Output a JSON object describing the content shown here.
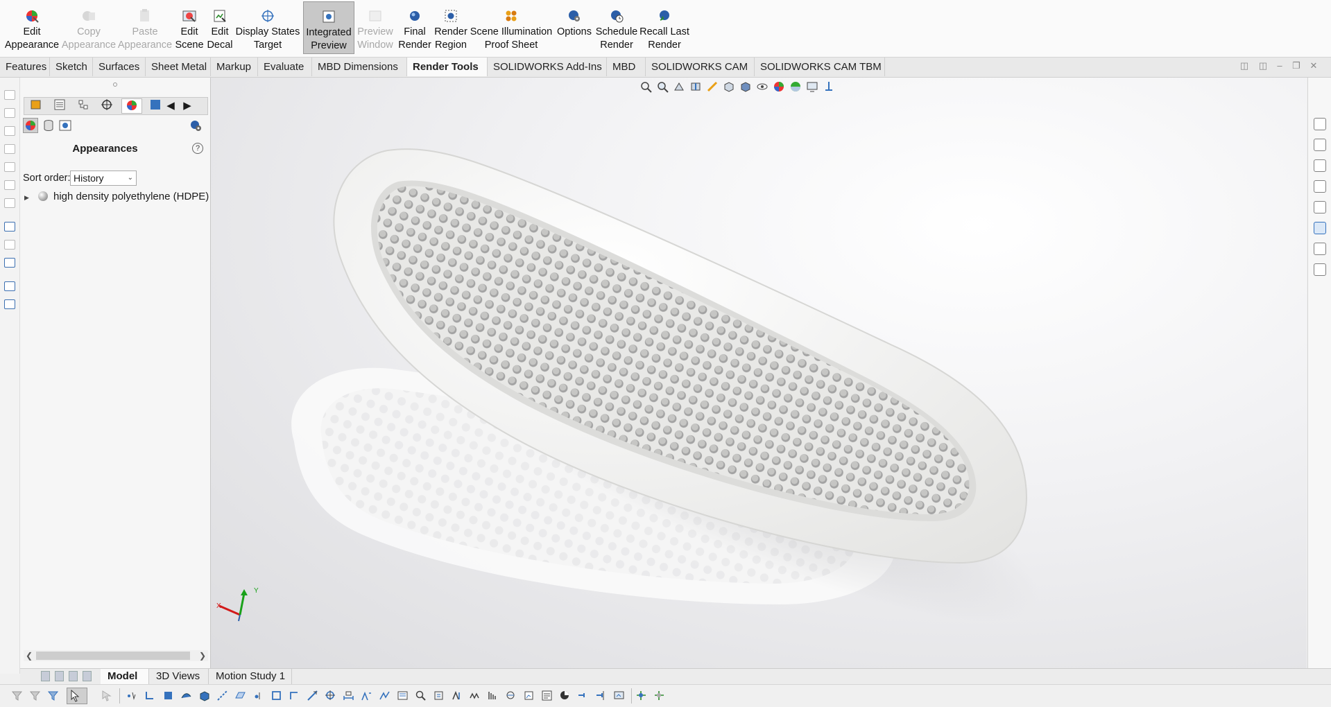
{
  "ribbon": {
    "buttons": [
      {
        "line1": "Edit",
        "line2": "Appearance",
        "icon": "edit-appearance-icon",
        "state": "enabled"
      },
      {
        "line1": "Copy",
        "line2": "Appearance",
        "icon": "copy-appearance-icon",
        "state": "disabled"
      },
      {
        "line1": "Paste",
        "line2": "Appearance",
        "icon": "paste-appearance-icon",
        "state": "disabled"
      },
      {
        "line1": "Edit",
        "line2": "Scene",
        "icon": "edit-scene-icon",
        "state": "enabled"
      },
      {
        "line1": "Edit",
        "line2": "Decal",
        "icon": "edit-decal-icon",
        "state": "enabled"
      },
      {
        "line1": "Display States",
        "line2": "Target",
        "icon": "display-states-target-icon",
        "state": "enabled"
      },
      {
        "line1": "Integrated",
        "line2": "Preview",
        "icon": "integrated-preview-icon",
        "state": "active"
      },
      {
        "line1": "Preview",
        "line2": "Window",
        "icon": "preview-window-icon",
        "state": "disabled"
      },
      {
        "line1": "Final",
        "line2": "Render",
        "icon": "final-render-icon",
        "state": "enabled"
      },
      {
        "line1": "Render",
        "line2": "Region",
        "icon": "render-region-icon",
        "state": "enabled"
      },
      {
        "line1": "Scene Illumination",
        "line2": "Proof Sheet",
        "icon": "scene-illumination-icon",
        "state": "enabled"
      },
      {
        "line1": "Options",
        "line2": "",
        "icon": "options-icon",
        "state": "enabled"
      },
      {
        "line1": "Schedule",
        "line2": "Render",
        "icon": "schedule-render-icon",
        "state": "enabled"
      },
      {
        "line1": "Recall Last",
        "line2": "Render",
        "icon": "recall-last-render-icon",
        "state": "enabled"
      }
    ]
  },
  "tabs": [
    "Features",
    "Sketch",
    "Surfaces",
    "Sheet Metal",
    "Markup",
    "Evaluate",
    "MBD Dimensions",
    "Render Tools",
    "SOLIDWORKS Add-Ins",
    "MBD",
    "SOLIDWORKS CAM",
    "SOLIDWORKS CAM TBM"
  ],
  "active_tab": "Render Tools",
  "panel": {
    "title": "Appearances",
    "help": "?",
    "sort_label": "Sort order:",
    "sort_value": "History",
    "tree_items": [
      {
        "label": "high density polyethylene (HDPE)",
        "icon": "sphere-icon"
      }
    ]
  },
  "triad": {
    "x_label": "X",
    "y_label": "Y"
  },
  "bottom_tabs": [
    "Model",
    "3D Views",
    "Motion Study 1"
  ],
  "active_bottom_tab": "Model",
  "colors": {
    "accent_blue": "#3572bd",
    "axis_x": "#d21a1a",
    "axis_y": "#1aa11a",
    "ribbon_bg": "#fafafa"
  }
}
